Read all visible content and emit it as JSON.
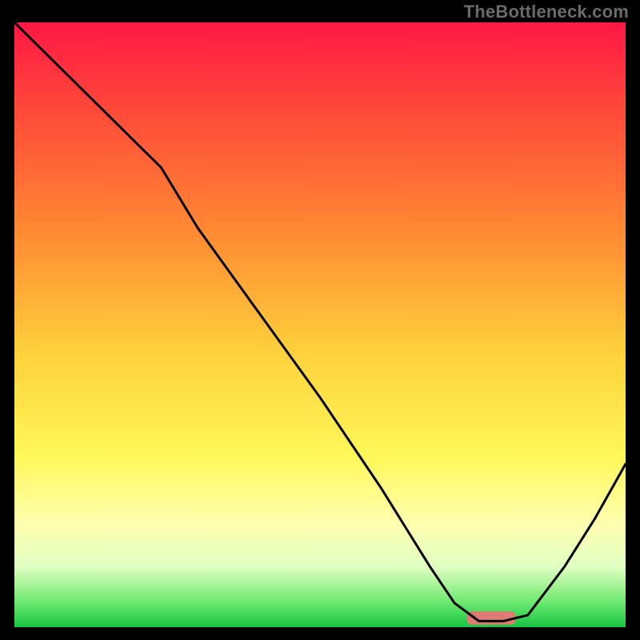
{
  "watermark": "TheBottleneck.com",
  "colors": {
    "text_gray": "#6b6b6b",
    "curve": "#000000",
    "black_border": "#000000"
  },
  "chart_data": {
    "type": "line",
    "title": "",
    "xlabel": "",
    "ylabel": "",
    "xlim": [
      0,
      100
    ],
    "ylim": [
      0,
      100
    ],
    "grid": false,
    "background": {
      "type": "vertical-gradient",
      "stops": [
        {
          "pos": 0,
          "color": "#ff1744"
        },
        {
          "pos": 15,
          "color": "#ff4b3a"
        },
        {
          "pos": 35,
          "color": "#ff8b32"
        },
        {
          "pos": 55,
          "color": "#ffd23c"
        },
        {
          "pos": 72,
          "color": "#fff85a"
        },
        {
          "pos": 83,
          "color": "#ffffb0"
        },
        {
          "pos": 90,
          "color": "#e0ffc2"
        },
        {
          "pos": 96,
          "color": "#6be86e"
        },
        {
          "pos": 100,
          "color": "#16c443"
        }
      ]
    },
    "series": [
      {
        "name": "bottleneck-curve",
        "x": [
          0,
          10,
          20,
          24,
          30,
          40,
          50,
          60,
          68,
          72,
          76,
          80,
          84,
          90,
          95,
          100
        ],
        "y": [
          100,
          90,
          80,
          76,
          66,
          52,
          38,
          23,
          10,
          4,
          1,
          1,
          2,
          10,
          18,
          27
        ]
      }
    ],
    "annotations": [
      {
        "name": "highlight-pill",
        "shape": "rounded-rect",
        "color": "#dd7b74",
        "x_range": [
          74,
          82
        ],
        "y": 1.5,
        "height": 2.2
      }
    ]
  }
}
